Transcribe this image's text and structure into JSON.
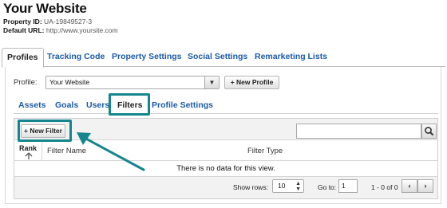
{
  "header": {
    "title": "Your Website",
    "property_id_label": "Property ID:",
    "property_id": "UA-19849527-3",
    "default_url_label": "Default URL:",
    "default_url": "http://www.yoursite.com"
  },
  "top_tabs": [
    {
      "label": "Profiles",
      "active": true
    },
    {
      "label": "Tracking Code",
      "active": false
    },
    {
      "label": "Property Settings",
      "active": false
    },
    {
      "label": "Social Settings",
      "active": false
    },
    {
      "label": "Remarketing Lists",
      "active": false
    }
  ],
  "profile": {
    "label": "Profile:",
    "selected": "Your Website",
    "new_profile_label": "+ New Profile"
  },
  "sub_tabs": [
    {
      "label": "Assets",
      "active": false
    },
    {
      "label": "Goals",
      "active": false
    },
    {
      "label": "Users",
      "active": false
    },
    {
      "label": "Filters",
      "active": true
    },
    {
      "label": "Profile Settings",
      "active": false
    }
  ],
  "filters_table": {
    "new_filter_label": "+ New Filter",
    "search_placeholder": "",
    "columns": [
      "Rank",
      "Filter Name",
      "Filter Type"
    ],
    "empty_message": "There is no data for this view.",
    "show_rows_label": "Show rows:",
    "show_rows_value": "10",
    "goto_label": "Go to:",
    "goto_value": "1",
    "range_label": "1 - 0 of 0"
  },
  "annotation": {
    "highlight_color": "#14868d"
  },
  "icons": {
    "sort_up": "arrow-up-icon",
    "search": "search-icon",
    "dropdown": "caret-down-icon",
    "prev": "chevron-left-icon",
    "next": "chevron-right-icon"
  }
}
